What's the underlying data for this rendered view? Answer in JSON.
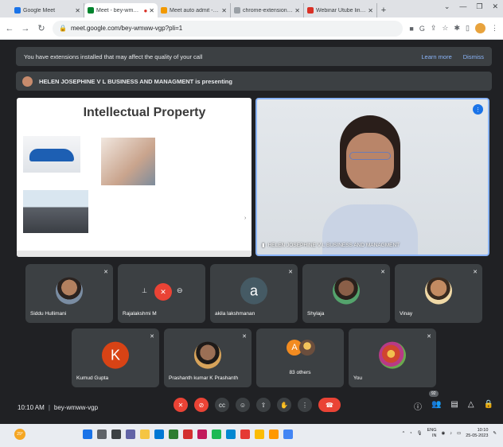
{
  "browser": {
    "tabs": [
      {
        "title": "Google Meet",
        "color": "#1a73e8",
        "active": false
      },
      {
        "title": "Meet - bey-wmww-v",
        "color": "#00832d",
        "active": true
      },
      {
        "title": "Meet auto admit - Chron",
        "color": "#f29900",
        "active": false
      },
      {
        "title": "chrome-extension://spo",
        "color": "#9aa0a6",
        "active": false
      },
      {
        "title": "Webinar Utube link - um",
        "color": "#d93025",
        "active": false
      }
    ],
    "new_tab": "+",
    "url": "meet.google.com/bey-wmww-vgp?pli=1"
  },
  "meet": {
    "notice_text": "You have extensions installed that may affect the quality of your call",
    "learn_more": "Learn more",
    "dismiss": "Dismiss",
    "presenting_text": "HELEN JOSEPHINE V L BUSINESS AND MANAGMENT is presenting",
    "slide_title": "Intellectual Property",
    "presenter_name": "HELEN JOSEPHINE V L BUSINESS AND MANAGMENT",
    "participants": [
      {
        "name": "Siddu Hullimani"
      },
      {
        "name": "Rajalakshmi M"
      },
      {
        "name": "akila lakshmanan",
        "initial": "a",
        "color": "#455a64"
      },
      {
        "name": "Shylaja"
      },
      {
        "name": "Vinay"
      },
      {
        "name": "Kumud Gupta",
        "initial": "K",
        "color": "#d84315"
      },
      {
        "name": "Prashanth kumar K Prashanth"
      },
      {
        "name": "You"
      }
    ],
    "others_initial": "A",
    "others_label": "83 others",
    "time": "10:10 AM",
    "meeting_code": "bey-wmww-vgp",
    "people_count": "92"
  },
  "taskbar": {
    "weather": "29°",
    "lang_top": "ENG",
    "lang_bottom": "IN",
    "time": "10:10",
    "date": "25-05-2023"
  }
}
